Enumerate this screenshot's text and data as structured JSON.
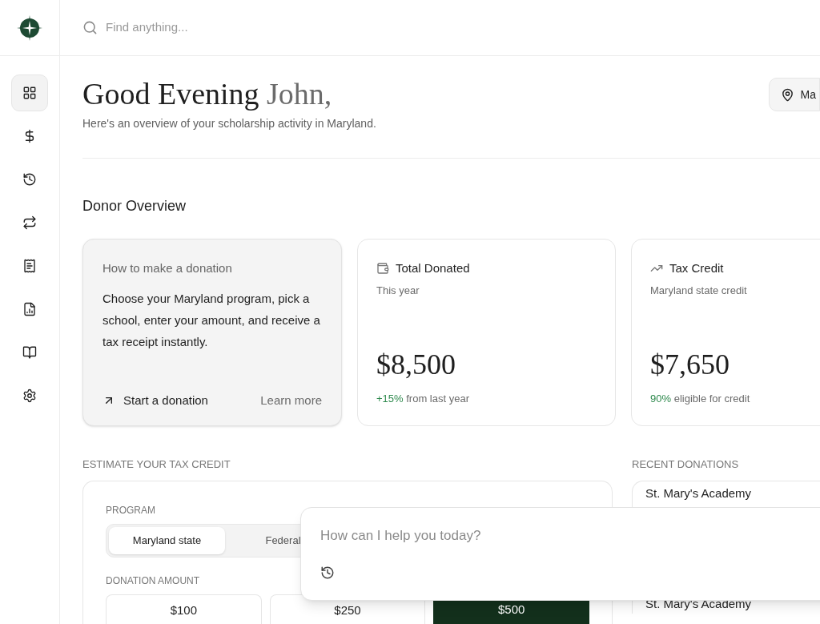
{
  "search": {
    "placeholder": "Find anything..."
  },
  "nav": [
    {
      "selected": true
    },
    {
      "selected": false
    },
    {
      "selected": false
    },
    {
      "selected": false
    },
    {
      "selected": false
    },
    {
      "selected": false
    },
    {
      "selected": false
    },
    {
      "selected": false
    }
  ],
  "greeting": {
    "title": "Good Evening",
    "name": "John,",
    "subtitle": "Here's an overview of your scholarship activity in Maryland."
  },
  "location_button": {
    "label": "Ma"
  },
  "section_title": "Donor Overview",
  "how_to": {
    "title": "How to make a donation",
    "body": "Choose your Maryland program, pick a school, enter your amount, and receive a tax receipt instantly.",
    "action": "Start a donation",
    "link": "Learn more"
  },
  "stats": [
    {
      "title": "Total Donated",
      "subtitle": "This year",
      "value": "$8,500",
      "change": "+15%",
      "note": "from last year"
    },
    {
      "title": "Tax Credit",
      "subtitle": "Maryland state credit",
      "value": "$7,650",
      "change": "90%",
      "note": "eligible for credit"
    }
  ],
  "estimator": {
    "heading": "ESTIMATE YOUR TAX CREDIT",
    "program_label": "PROGRAM",
    "programs": [
      {
        "label": "Maryland state",
        "selected": true
      },
      {
        "label": "Federal",
        "selected": false
      }
    ],
    "amount_label": "DONATION AMOUNT",
    "amounts": [
      {
        "label": "$100",
        "selected": false
      },
      {
        "label": "$250",
        "selected": false
      },
      {
        "label": "$500",
        "selected": true
      }
    ]
  },
  "recent": {
    "heading": "RECENT DONATIONS",
    "items": [
      "St. Mary's Academy",
      "St. Mary's Academy"
    ]
  },
  "chat": {
    "placeholder": "How can I help you today?"
  }
}
